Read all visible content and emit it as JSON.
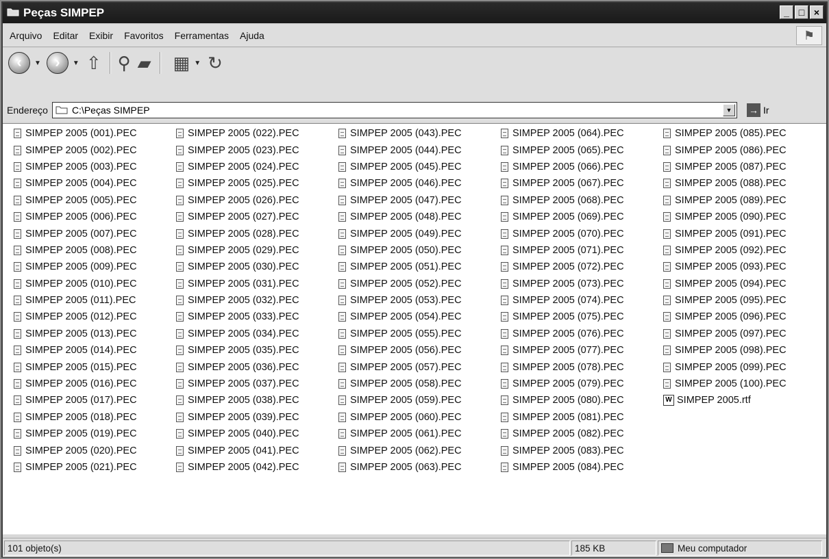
{
  "window": {
    "title": "Peças SIMPEP"
  },
  "menu": [
    "Arquivo",
    "Editar",
    "Exibir",
    "Favoritos",
    "Ferramentas",
    "Ajuda"
  ],
  "address": {
    "label": "Endereço",
    "path": "C:\\Peças SIMPEP",
    "go_label": "Ir"
  },
  "files": {
    "columns": [
      [
        "SIMPEP 2005 (001).PEC",
        "SIMPEP 2005 (002).PEC",
        "SIMPEP 2005 (003).PEC",
        "SIMPEP 2005 (004).PEC",
        "SIMPEP 2005 (005).PEC",
        "SIMPEP 2005 (006).PEC",
        "SIMPEP 2005 (007).PEC",
        "SIMPEP 2005 (008).PEC",
        "SIMPEP 2005 (009).PEC",
        "SIMPEP 2005 (010).PEC",
        "SIMPEP 2005 (011).PEC",
        "SIMPEP 2005 (012).PEC",
        "SIMPEP 2005 (013).PEC",
        "SIMPEP 2005 (014).PEC",
        "SIMPEP 2005 (015).PEC",
        "SIMPEP 2005 (016).PEC",
        "SIMPEP 2005 (017).PEC",
        "SIMPEP 2005 (018).PEC",
        "SIMPEP 2005 (019).PEC",
        "SIMPEP 2005 (020).PEC",
        "SIMPEP 2005 (021).PEC"
      ],
      [
        "SIMPEP 2005 (022).PEC",
        "SIMPEP 2005 (023).PEC",
        "SIMPEP 2005 (024).PEC",
        "SIMPEP 2005 (025).PEC",
        "SIMPEP 2005 (026).PEC",
        "SIMPEP 2005 (027).PEC",
        "SIMPEP 2005 (028).PEC",
        "SIMPEP 2005 (029).PEC",
        "SIMPEP 2005 (030).PEC",
        "SIMPEP 2005 (031).PEC",
        "SIMPEP 2005 (032).PEC",
        "SIMPEP 2005 (033).PEC",
        "SIMPEP 2005 (034).PEC",
        "SIMPEP 2005 (035).PEC",
        "SIMPEP 2005 (036).PEC",
        "SIMPEP 2005 (037).PEC",
        "SIMPEP 2005 (038).PEC",
        "SIMPEP 2005 (039).PEC",
        "SIMPEP 2005 (040).PEC",
        "SIMPEP 2005 (041).PEC",
        "SIMPEP 2005 (042).PEC"
      ],
      [
        "SIMPEP 2005 (043).PEC",
        "SIMPEP 2005 (044).PEC",
        "SIMPEP 2005 (045).PEC",
        "SIMPEP 2005 (046).PEC",
        "SIMPEP 2005 (047).PEC",
        "SIMPEP 2005 (048).PEC",
        "SIMPEP 2005 (049).PEC",
        "SIMPEP 2005 (050).PEC",
        "SIMPEP 2005 (051).PEC",
        "SIMPEP 2005 (052).PEC",
        "SIMPEP 2005 (053).PEC",
        "SIMPEP 2005 (054).PEC",
        "SIMPEP 2005 (055).PEC",
        "SIMPEP 2005 (056).PEC",
        "SIMPEP 2005 (057).PEC",
        "SIMPEP 2005 (058).PEC",
        "SIMPEP 2005 (059).PEC",
        "SIMPEP 2005 (060).PEC",
        "SIMPEP 2005 (061).PEC",
        "SIMPEP 2005 (062).PEC",
        "SIMPEP 2005 (063).PEC"
      ],
      [
        "SIMPEP 2005 (064).PEC",
        "SIMPEP 2005 (065).PEC",
        "SIMPEP 2005 (066).PEC",
        "SIMPEP 2005 (067).PEC",
        "SIMPEP 2005 (068).PEC",
        "SIMPEP 2005 (069).PEC",
        "SIMPEP 2005 (070).PEC",
        "SIMPEP 2005 (071).PEC",
        "SIMPEP 2005 (072).PEC",
        "SIMPEP 2005 (073).PEC",
        "SIMPEP 2005 (074).PEC",
        "SIMPEP 2005 (075).PEC",
        "SIMPEP 2005 (076).PEC",
        "SIMPEP 2005 (077).PEC",
        "SIMPEP 2005 (078).PEC",
        "SIMPEP 2005 (079).PEC",
        "SIMPEP 2005 (080).PEC",
        "SIMPEP 2005 (081).PEC",
        "SIMPEP 2005 (082).PEC",
        "SIMPEP 2005 (083).PEC",
        "SIMPEP 2005 (084).PEC"
      ],
      [
        "SIMPEP 2005 (085).PEC",
        "SIMPEP 2005 (086).PEC",
        "SIMPEP 2005 (087).PEC",
        "SIMPEP 2005 (088).PEC",
        "SIMPEP 2005 (089).PEC",
        "SIMPEP 2005 (090).PEC",
        "SIMPEP 2005 (091).PEC",
        "SIMPEP 2005 (092).PEC",
        "SIMPEP 2005 (093).PEC",
        "SIMPEP 2005 (094).PEC",
        "SIMPEP 2005 (095).PEC",
        "SIMPEP 2005 (096).PEC",
        "SIMPEP 2005 (097).PEC",
        "SIMPEP 2005 (098).PEC",
        "SIMPEP 2005 (099).PEC",
        "SIMPEP 2005 (100).PEC",
        "SIMPEP 2005.rtf"
      ]
    ]
  },
  "status": {
    "count": "101 objeto(s)",
    "size": "185 KB",
    "location": "Meu computador"
  },
  "icons": {
    "title": "folder-icon",
    "back": "back-arrow-icon",
    "forward": "forward-arrow-icon",
    "up": "up-folder-icon",
    "search": "search-icon",
    "folders": "folders-icon",
    "views": "views-icon",
    "refresh": "refresh-icon",
    "pec_file": "document-icon",
    "rtf_file": "word-document-icon"
  }
}
